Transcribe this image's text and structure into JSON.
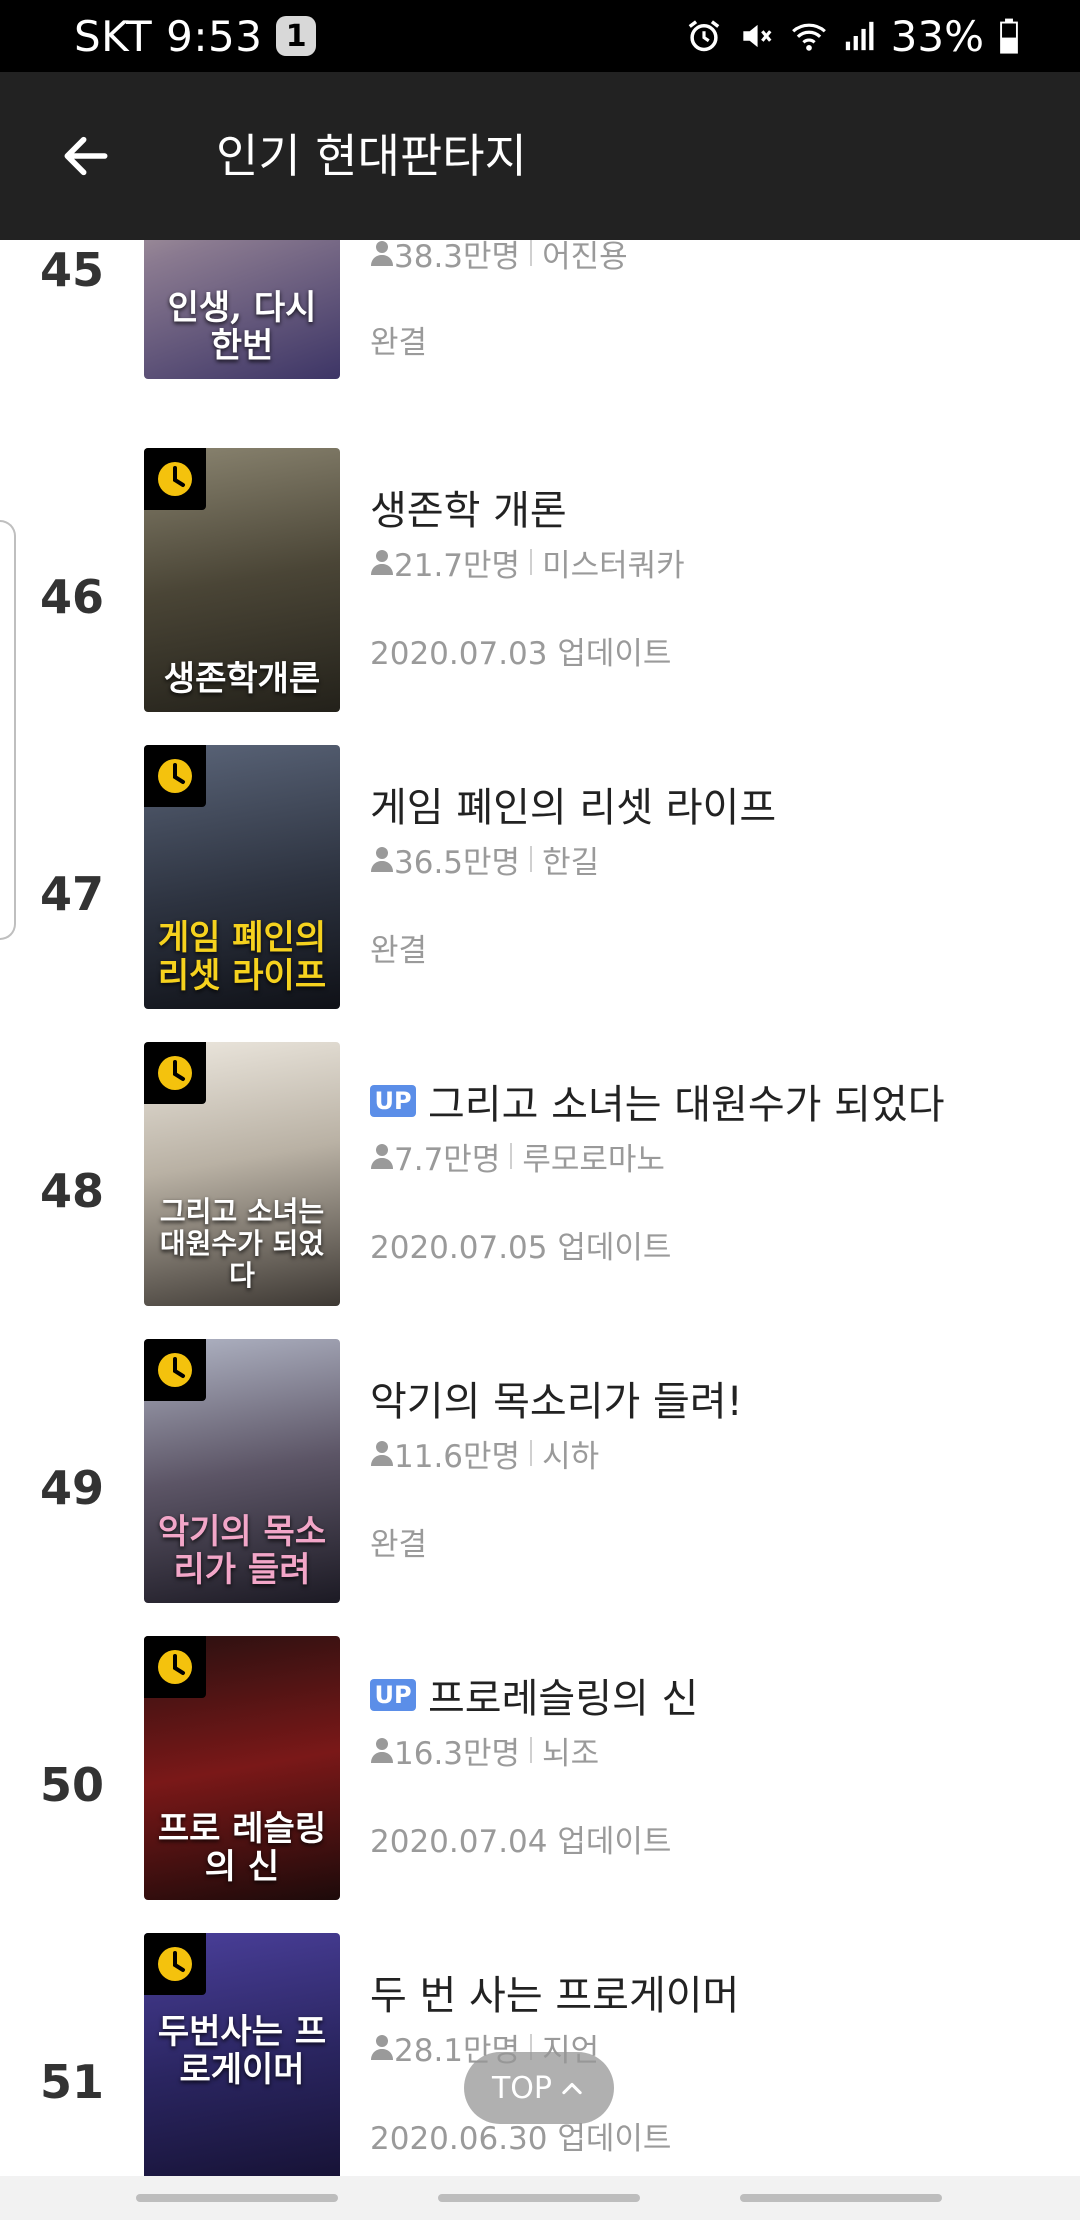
{
  "status_bar": {
    "carrier": "SKT",
    "time": "9:53",
    "notification_count": "1",
    "battery": "33%",
    "icons": [
      "alarm-icon",
      "mute-icon",
      "wifi-icon",
      "signal-icon",
      "battery-icon"
    ]
  },
  "app_bar": {
    "back_icon": "arrow-left-icon",
    "title": "인기 현대판타지"
  },
  "items": [
    {
      "rank": "45",
      "title": "",
      "up": false,
      "wait_free": false,
      "views": "38.3만명",
      "author": "어진용",
      "status": "완결",
      "cover_text": "인생, 다시 한번",
      "cover_colors": [
        "#c9b8a8",
        "#4a3f6b"
      ]
    },
    {
      "rank": "46",
      "title": "생존학 개론",
      "up": false,
      "wait_free": true,
      "views": "21.7만명",
      "author": "미스터쿼카",
      "status": "2020.07.03 업데이트",
      "cover_text": "생존학개론",
      "cover_colors": [
        "#6b6552",
        "#2e2b22"
      ]
    },
    {
      "rank": "47",
      "title": "게임 폐인의 리셋 라이프",
      "up": false,
      "wait_free": true,
      "views": "36.5만명",
      "author": "한길",
      "status": "완결",
      "cover_text": "게임 폐인의 리셋 라이프",
      "cover_colors": [
        "#3a4356",
        "#161a22"
      ]
    },
    {
      "rank": "48",
      "title": "그리고 소녀는 대원수가 되었다",
      "up": true,
      "wait_free": true,
      "views": "7.7만명",
      "author": "루모로마노",
      "status": "2020.07.05 업데이트",
      "cover_text": "그리고 소녀는 대원수가 되었다",
      "cover_colors": [
        "#e8e2d8",
        "#3d3833"
      ]
    },
    {
      "rank": "49",
      "title": "악기의 목소리가 들려!",
      "up": false,
      "wait_free": true,
      "views": "11.6만명",
      "author": "시하",
      "status": "완결",
      "cover_text": "악기의 목소리가 들려",
      "cover_colors": [
        "#8a8ea0",
        "#2a2630"
      ]
    },
    {
      "rank": "50",
      "title": "프로레슬링의 신",
      "up": true,
      "wait_free": true,
      "views": "16.3만명",
      "author": "뇌조",
      "status": "2020.07.04 업데이트",
      "cover_text": "프로 레슬링의 신",
      "cover_colors": [
        "#7a1818",
        "#1d0a0a"
      ]
    },
    {
      "rank": "51",
      "title": "두 번 사는 프로게이머",
      "up": false,
      "wait_free": true,
      "views": "28.1만명",
      "author": "지언",
      "status": "2020.06.30 업데이트",
      "cover_text": "두번사는 프로게이머",
      "cover_colors": [
        "#3b3a7a",
        "#1a1533"
      ]
    }
  ],
  "up_badge_label": "UP",
  "top_button": {
    "label": "TOP",
    "icon": "chevron-up-icon"
  }
}
